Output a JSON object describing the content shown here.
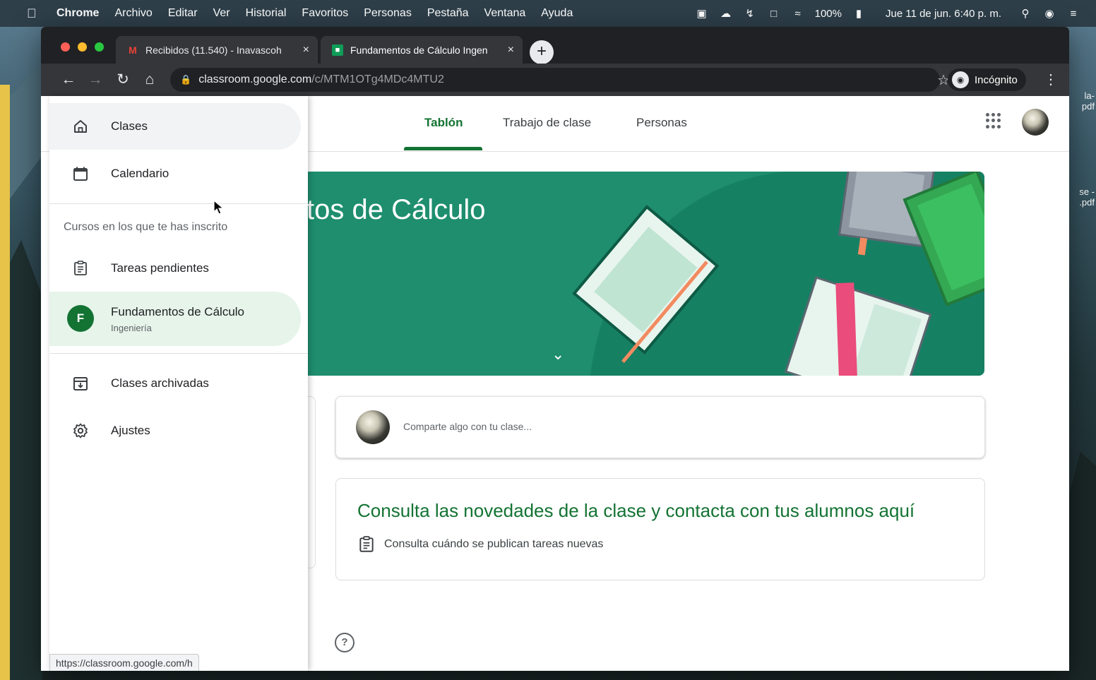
{
  "menubar": {
    "app_name": "Chrome",
    "items": [
      "Archivo",
      "Editar",
      "Ver",
      "Historial",
      "Favoritos",
      "Personas",
      "Pestaña",
      "Ventana",
      "Ayuda"
    ],
    "battery": "100%",
    "datetime": "Jue 11 de jun.  6:40 p. m."
  },
  "desktop": {
    "icon1_label": "la-\npdf",
    "icon2_label": "se -\n.pdf"
  },
  "browser": {
    "tabs": [
      {
        "label": "Recibidos (11.540) - Inavascoh",
        "favicon": "gmail-icon",
        "active": false
      },
      {
        "label": "Fundamentos de Cálculo Ingen",
        "favicon": "classroom-icon",
        "active": true
      }
    ],
    "url_host": "classroom.google.com",
    "url_path": "/c/MTM1OTg4MDc4MTU2",
    "incognito_label": "Incógnito",
    "status_url": "https://classroom.google.com/h"
  },
  "page": {
    "nav_tabs": [
      "Tablón",
      "Trabajo de clase",
      "Personas"
    ],
    "active_tab": "Tablón",
    "banner_title": "tos de Cálculo",
    "share_placeholder": "Comparte algo con tu clase...",
    "info_heading": "Consulta las novedades de la clase y contacta con tus alumnos aquí",
    "info_item": "Consulta cuándo se publican tareas nuevas",
    "help_glyph": "?"
  },
  "drawer": {
    "items_top": [
      {
        "label": "Clases",
        "icon": "home-icon"
      },
      {
        "label": "Calendario",
        "icon": "calendar-icon"
      }
    ],
    "enrolled_section": "Cursos en los que te has inscrito",
    "todo_label": "Tareas pendientes",
    "course": {
      "badge": "F",
      "title": "Fundamentos de Cálculo",
      "subtitle": "Ingeniería"
    },
    "items_bottom": [
      {
        "label": "Clases archivadas",
        "icon": "archive-icon"
      },
      {
        "label": "Ajustes",
        "icon": "gear-icon"
      }
    ]
  },
  "colors": {
    "classroom_green": "#137333",
    "banner_teal": "#1e8e6e",
    "chrome_dark": "#202124"
  }
}
